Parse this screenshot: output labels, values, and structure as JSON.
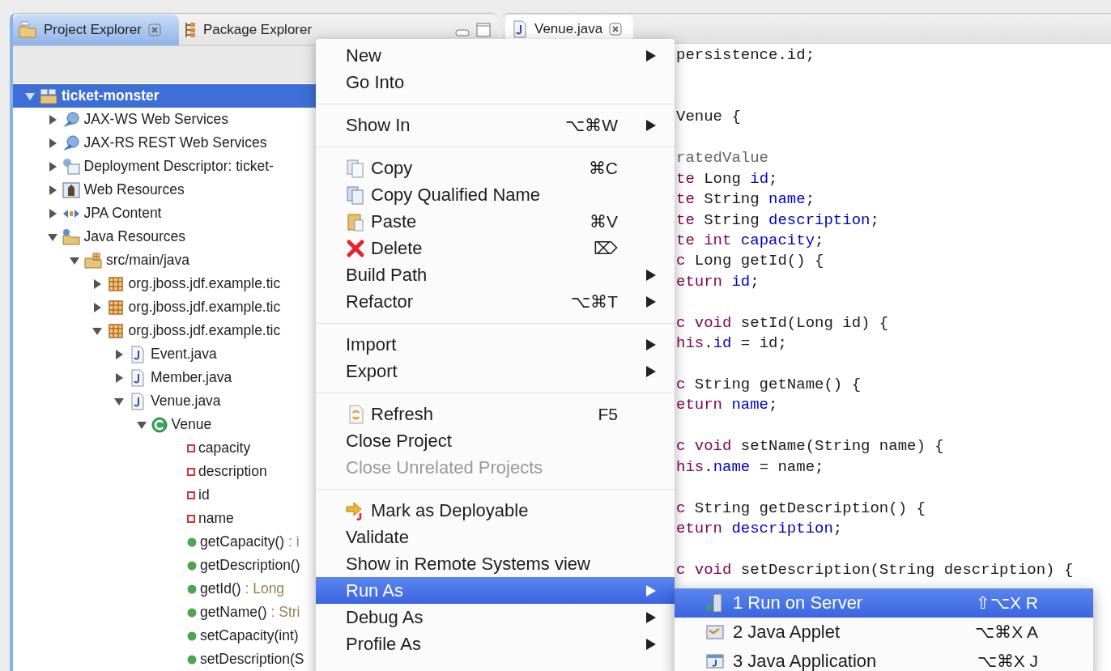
{
  "explorer": {
    "tabs": [
      {
        "label": "Project Explorer",
        "kind": "project",
        "selected": true,
        "closable": true
      },
      {
        "label": "Package Explorer",
        "kind": "package",
        "selected": false,
        "closable": false
      }
    ],
    "tree": [
      {
        "kind": "project",
        "label": "ticket-monster",
        "selected": true,
        "expanded": true,
        "children": [
          {
            "kind": "webservices",
            "label": "JAX-WS Web Services",
            "selected": false,
            "expanded": false
          },
          {
            "kind": "webservices",
            "label": "JAX-RS REST Web Services",
            "selected": false,
            "expanded": false
          },
          {
            "kind": "descriptor",
            "label": "Deployment Descriptor: ticket-",
            "selected": false,
            "expanded": false
          },
          {
            "kind": "webres",
            "label": "Web Resources",
            "selected": false,
            "expanded": false
          },
          {
            "kind": "jpa",
            "label": "JPA Content",
            "selected": false,
            "expanded": false
          },
          {
            "kind": "javares",
            "label": "Java Resources",
            "selected": false,
            "expanded": true,
            "children": [
              {
                "kind": "srcfolder",
                "label": "src/main/java",
                "selected": false,
                "expanded": true,
                "children": [
                  {
                    "kind": "package",
                    "label": "org.jboss.jdf.example.tic",
                    "selected": false,
                    "expanded": false
                  },
                  {
                    "kind": "package",
                    "label": "org.jboss.jdf.example.tic",
                    "selected": false,
                    "expanded": false
                  },
                  {
                    "kind": "package",
                    "label": "org.jboss.jdf.example.tic",
                    "selected": false,
                    "expanded": true,
                    "children": [
                      {
                        "kind": "javafile",
                        "label": "Event.java",
                        "selected": false,
                        "expanded": false
                      },
                      {
                        "kind": "javafile",
                        "label": "Member.java",
                        "selected": false,
                        "expanded": false
                      },
                      {
                        "kind": "javafile",
                        "label": "Venue.java",
                        "selected": false,
                        "expanded": true,
                        "children": [
                          {
                            "kind": "class",
                            "label": "Venue",
                            "selected": false,
                            "expanded": true,
                            "children": [
                              {
                                "kind": "field",
                                "label": "capacity",
                                "selected": false
                              },
                              {
                                "kind": "field",
                                "label": "description",
                                "selected": false
                              },
                              {
                                "kind": "field",
                                "label": "id",
                                "selected": false
                              },
                              {
                                "kind": "field",
                                "label": "name",
                                "selected": false
                              },
                              {
                                "kind": "method",
                                "label": "getCapacity()",
                                "suffix": " : i",
                                "selected": false
                              },
                              {
                                "kind": "method",
                                "label": "getDescription()",
                                "selected": false
                              },
                              {
                                "kind": "method",
                                "label": "getId()",
                                "suffix": " : Long",
                                "selected": false
                              },
                              {
                                "kind": "method",
                                "label": "getName()",
                                "suffix": " : Stri",
                                "selected": false
                              },
                              {
                                "kind": "method",
                                "label": "setCapacity(int)",
                                "selected": false
                              },
                              {
                                "kind": "method",
                                "label": "setDescription(S",
                                "selected": false
                              }
                            ]
                          }
                        ]
                      }
                    ]
                  }
                ]
              }
            ]
          }
        ]
      }
    ]
  },
  "editor": {
    "tab": {
      "label": "Venue.java",
      "selected": true
    },
    "lines": [
      {
        "kind": "code",
        "segments": [
          {
            "kind": "plain",
            "text": "persistence.id;"
          }
        ]
      },
      {
        "kind": "blank"
      },
      {
        "kind": "blank"
      },
      {
        "kind": "code",
        "segments": [
          {
            "kind": "plain",
            "text": "Venue {"
          }
        ]
      },
      {
        "kind": "blank"
      },
      {
        "kind": "code",
        "segments": [
          {
            "kind": "annotation",
            "text": "ratedValue"
          }
        ]
      },
      {
        "kind": "code",
        "segments": [
          {
            "kind": "keyword",
            "text": "te"
          },
          {
            "kind": "plain",
            "text": " Long "
          },
          {
            "kind": "field",
            "text": "id"
          },
          {
            "kind": "plain",
            "text": ";"
          }
        ]
      },
      {
        "kind": "code",
        "segments": [
          {
            "kind": "keyword",
            "text": "te"
          },
          {
            "kind": "plain",
            "text": " String "
          },
          {
            "kind": "field",
            "text": "name"
          },
          {
            "kind": "plain",
            "text": ";"
          }
        ]
      },
      {
        "kind": "code",
        "segments": [
          {
            "kind": "keyword",
            "text": "te"
          },
          {
            "kind": "plain",
            "text": " String "
          },
          {
            "kind": "field",
            "text": "description"
          },
          {
            "kind": "plain",
            "text": ";"
          }
        ]
      },
      {
        "kind": "code",
        "segments": [
          {
            "kind": "keyword",
            "text": "te"
          },
          {
            "kind": "keyword",
            "text": " int"
          },
          {
            "kind": "field",
            "text": " capacity"
          },
          {
            "kind": "plain",
            "text": ";"
          }
        ]
      },
      {
        "kind": "code",
        "segments": [
          {
            "kind": "keyword",
            "text": "c"
          },
          {
            "kind": "plain",
            "text": " Long getId() {"
          }
        ]
      },
      {
        "kind": "code",
        "segments": [
          {
            "kind": "keyword",
            "text": "eturn"
          },
          {
            "kind": "field",
            "text": " id"
          },
          {
            "kind": "plain",
            "text": ";"
          }
        ]
      },
      {
        "kind": "blank"
      },
      {
        "kind": "code",
        "segments": [
          {
            "kind": "keyword",
            "text": "c"
          },
          {
            "kind": "keyword",
            "text": " void"
          },
          {
            "kind": "plain",
            "text": " setId(Long id) {"
          }
        ]
      },
      {
        "kind": "code",
        "segments": [
          {
            "kind": "keyword",
            "text": "his"
          },
          {
            "kind": "plain",
            "text": "."
          },
          {
            "kind": "field",
            "text": "id"
          },
          {
            "kind": "plain",
            "text": " = id;"
          }
        ]
      },
      {
        "kind": "blank"
      },
      {
        "kind": "code",
        "segments": [
          {
            "kind": "keyword",
            "text": "c"
          },
          {
            "kind": "plain",
            "text": " String getName() {"
          }
        ]
      },
      {
        "kind": "code",
        "segments": [
          {
            "kind": "keyword",
            "text": "eturn"
          },
          {
            "kind": "field",
            "text": " name"
          },
          {
            "kind": "plain",
            "text": ";"
          }
        ]
      },
      {
        "kind": "blank"
      },
      {
        "kind": "code",
        "segments": [
          {
            "kind": "keyword",
            "text": "c"
          },
          {
            "kind": "keyword",
            "text": " void"
          },
          {
            "kind": "plain",
            "text": " setName(String name) {"
          }
        ]
      },
      {
        "kind": "code",
        "segments": [
          {
            "kind": "keyword",
            "text": "his"
          },
          {
            "kind": "plain",
            "text": "."
          },
          {
            "kind": "field",
            "text": "name"
          },
          {
            "kind": "plain",
            "text": " = name;"
          }
        ]
      },
      {
        "kind": "blank"
      },
      {
        "kind": "code",
        "segments": [
          {
            "kind": "keyword",
            "text": "c"
          },
          {
            "kind": "plain",
            "text": " String getDescription() {"
          }
        ]
      },
      {
        "kind": "code",
        "segments": [
          {
            "kind": "keyword",
            "text": "eturn"
          },
          {
            "kind": "field",
            "text": " description"
          },
          {
            "kind": "plain",
            "text": ";"
          }
        ]
      },
      {
        "kind": "blank"
      },
      {
        "kind": "code",
        "segments": [
          {
            "kind": "keyword",
            "text": "c"
          },
          {
            "kind": "keyword",
            "text": " void"
          },
          {
            "kind": "plain",
            "text": " setDescription(String description) {"
          }
        ]
      }
    ]
  },
  "context_menu": {
    "items": [
      {
        "kind": "item",
        "label": "New",
        "submenu": true,
        "selected": false,
        "disabled": false
      },
      {
        "kind": "item",
        "label": "Go Into",
        "submenu": false,
        "selected": false,
        "disabled": false
      },
      {
        "kind": "separator"
      },
      {
        "kind": "item",
        "label": "Show In",
        "shortcut": "⌥⌘W",
        "submenu": true,
        "selected": false,
        "disabled": false
      },
      {
        "kind": "separator"
      },
      {
        "kind": "copy",
        "label": "Copy",
        "shortcut": "⌘C",
        "submenu": false,
        "selected": false,
        "disabled": false
      },
      {
        "kind": "copy-qualified",
        "label": "Copy Qualified Name",
        "submenu": false,
        "selected": false,
        "disabled": false
      },
      {
        "kind": "paste",
        "label": "Paste",
        "shortcut": "⌘V",
        "submenu": false,
        "selected": false,
        "disabled": false
      },
      {
        "kind": "delete",
        "label": "Delete",
        "shortcut": "⌦",
        "submenu": false,
        "selected": false,
        "disabled": false
      },
      {
        "kind": "item",
        "label": "Build Path",
        "submenu": true,
        "selected": false,
        "disabled": false
      },
      {
        "kind": "item",
        "label": "Refactor",
        "shortcut": "⌥⌘T",
        "submenu": true,
        "selected": false,
        "disabled": false
      },
      {
        "kind": "separator"
      },
      {
        "kind": "item",
        "label": "Import",
        "submenu": true,
        "selected": false,
        "disabled": false
      },
      {
        "kind": "item",
        "label": "Export",
        "submenu": true,
        "selected": false,
        "disabled": false
      },
      {
        "kind": "separator"
      },
      {
        "kind": "refresh",
        "label": "Refresh",
        "shortcut": "F5",
        "submenu": false,
        "selected": false,
        "disabled": false
      },
      {
        "kind": "item",
        "label": "Close Project",
        "submenu": false,
        "selected": false,
        "disabled": false
      },
      {
        "kind": "item",
        "label": "Close Unrelated Projects",
        "submenu": false,
        "selected": false,
        "disabled": true
      },
      {
        "kind": "separator"
      },
      {
        "kind": "deployable",
        "label": "Mark as Deployable",
        "submenu": false,
        "selected": false,
        "disabled": false
      },
      {
        "kind": "item",
        "label": "Validate",
        "submenu": false,
        "selected": false,
        "disabled": false
      },
      {
        "kind": "item",
        "label": "Show in Remote Systems view",
        "submenu": false,
        "selected": false,
        "disabled": false
      },
      {
        "kind": "item",
        "label": "Run As",
        "submenu": true,
        "selected": true,
        "disabled": false
      },
      {
        "kind": "item",
        "label": "Debug As",
        "submenu": true,
        "selected": false,
        "disabled": false
      },
      {
        "kind": "item",
        "label": "Profile As",
        "submenu": true,
        "selected": false,
        "disabled": false
      }
    ]
  },
  "submenu": {
    "items": [
      {
        "kind": "server",
        "label": "1 Run on Server",
        "shortcut": "⇧⌥X R",
        "selected": true
      },
      {
        "kind": "applet",
        "label": "2 Java Applet",
        "shortcut": "⌥⌘X A",
        "selected": false
      },
      {
        "kind": "application",
        "label": "3 Java Application",
        "shortcut": "⌥⌘X J",
        "selected": false
      }
    ]
  }
}
